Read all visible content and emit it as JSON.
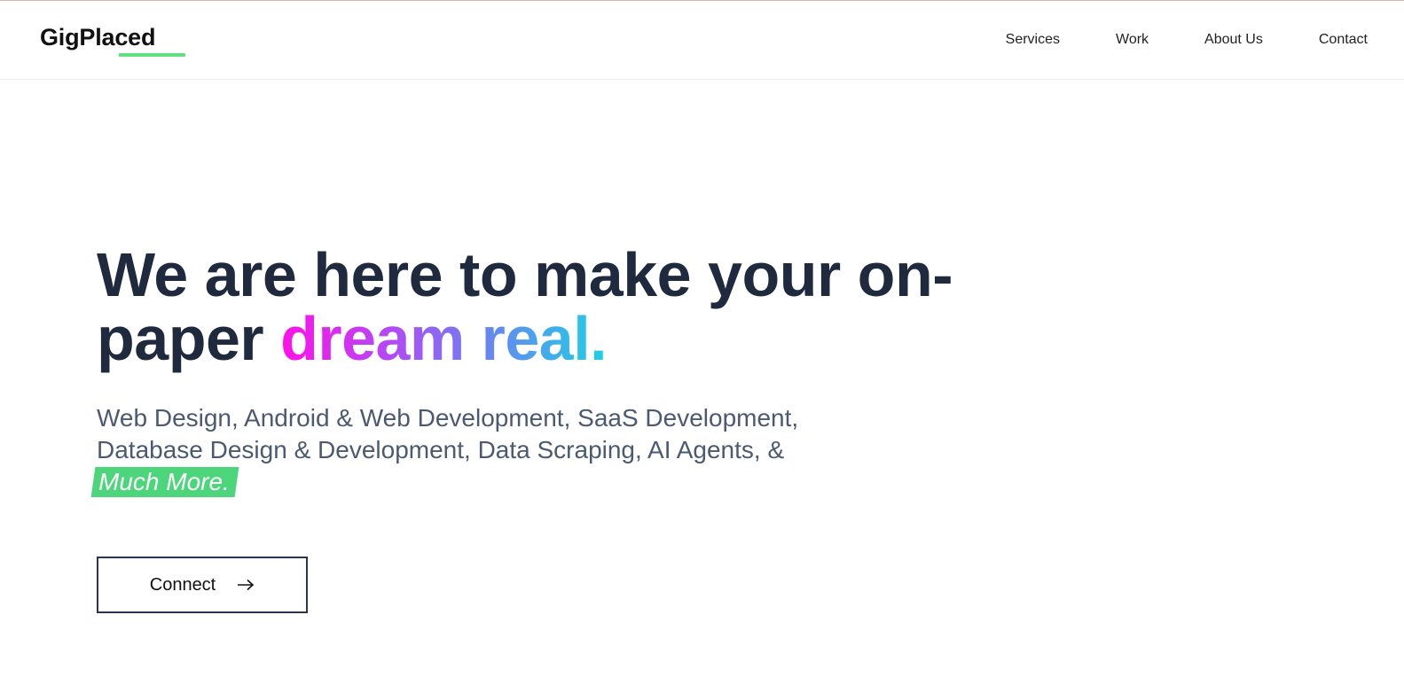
{
  "header": {
    "logo": "GigPlaced",
    "nav": [
      "Services",
      "Work",
      "About Us",
      "Contact"
    ]
  },
  "hero": {
    "headline_prefix": "We are here to make your on-paper ",
    "headline_highlight": "dream real.",
    "services_text": "Web Design, Android & Web Development, SaaS Development, Database Design & Development, Data Scraping, AI Agents, &",
    "services_highlight": "Much More.",
    "cta_label": "Connect",
    "cta_icon": "arrow-right-icon"
  },
  "colors": {
    "headline": "#1f2a3e",
    "accent_green": "#4cd57a",
    "gradient_start": "#ff10e8",
    "gradient_end": "#1fd0e6"
  }
}
